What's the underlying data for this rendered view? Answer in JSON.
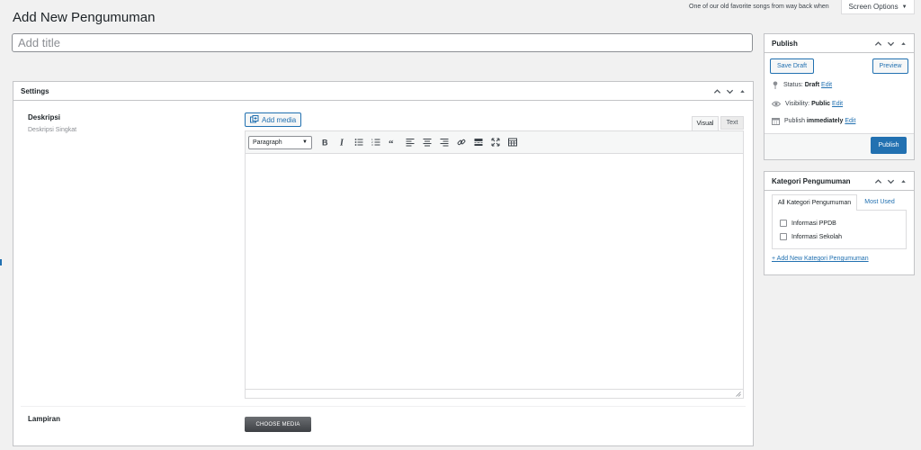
{
  "header": {
    "page_title": "Add New Pengumuman",
    "song_line": "One of our old favorite songs from way back when",
    "screen_options_label": "Screen Options"
  },
  "title_field": {
    "placeholder": "Add title",
    "value": ""
  },
  "settings": {
    "title": "Settings",
    "deskripsi_label": "Deskripsi",
    "deskripsi_desc": "Deskripsi Singkat",
    "add_media_label": "Add media",
    "tab_visual": "Visual",
    "tab_text": "Text",
    "format_select": "Paragraph",
    "toolbar_icons": [
      "bold-icon",
      "italic-icon",
      "bullet-list-icon",
      "numbered-list-icon",
      "blockquote-icon",
      "align-left-icon",
      "align-center-icon",
      "align-right-icon",
      "link-icon",
      "read-more-icon",
      "fullscreen-icon",
      "toolbar-toggle-icon"
    ],
    "lampiran_label": "Lampiran",
    "choose_media_label": "CHOOSE MEDIA"
  },
  "publish": {
    "title": "Publish",
    "save_draft_label": "Save Draft",
    "preview_label": "Preview",
    "status_prefix": "Status:",
    "status_value": "Draft",
    "visibility_prefix": "Visibility:",
    "visibility_value": "Public",
    "publish_prefix": "Publish",
    "publish_value": "immediately",
    "edit_label": "Edit",
    "publish_button_label": "Publish"
  },
  "kategori": {
    "title": "Kategori Pengumuman",
    "tab_all": "All Kategori Pengumuman",
    "tab_most_used": "Most Used",
    "items": [
      {
        "label": "Informasi PPDB",
        "checked": false
      },
      {
        "label": "Informasi Sekolah",
        "checked": false
      }
    ],
    "add_new_label": "+ Add New Kategori Pengumuman"
  },
  "colors": {
    "accent": "#2271b1",
    "background": "#f1f1f1",
    "border": "#c3c4c7"
  }
}
